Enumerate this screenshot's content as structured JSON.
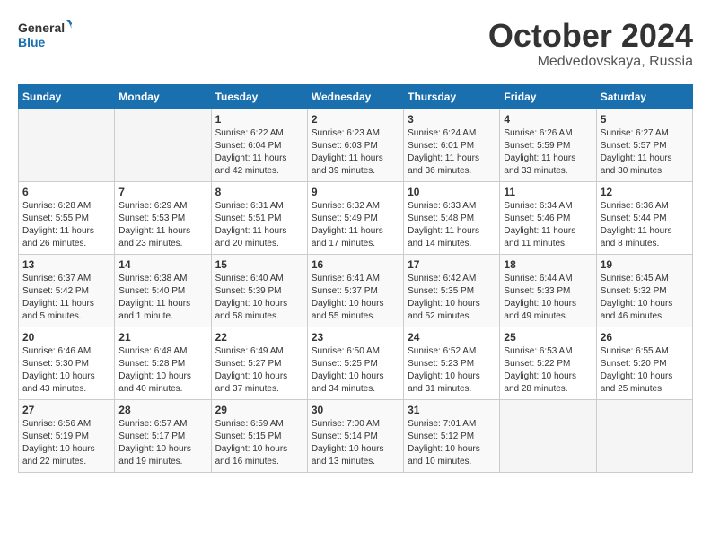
{
  "header": {
    "logo_line1": "General",
    "logo_line2": "Blue",
    "month": "October 2024",
    "location": "Medvedovskaya, Russia"
  },
  "weekdays": [
    "Sunday",
    "Monday",
    "Tuesday",
    "Wednesday",
    "Thursday",
    "Friday",
    "Saturday"
  ],
  "weeks": [
    [
      {
        "day": "",
        "sunrise": "",
        "sunset": "",
        "daylight": ""
      },
      {
        "day": "",
        "sunrise": "",
        "sunset": "",
        "daylight": ""
      },
      {
        "day": "1",
        "sunrise": "Sunrise: 6:22 AM",
        "sunset": "Sunset: 6:04 PM",
        "daylight": "Daylight: 11 hours and 42 minutes."
      },
      {
        "day": "2",
        "sunrise": "Sunrise: 6:23 AM",
        "sunset": "Sunset: 6:03 PM",
        "daylight": "Daylight: 11 hours and 39 minutes."
      },
      {
        "day": "3",
        "sunrise": "Sunrise: 6:24 AM",
        "sunset": "Sunset: 6:01 PM",
        "daylight": "Daylight: 11 hours and 36 minutes."
      },
      {
        "day": "4",
        "sunrise": "Sunrise: 6:26 AM",
        "sunset": "Sunset: 5:59 PM",
        "daylight": "Daylight: 11 hours and 33 minutes."
      },
      {
        "day": "5",
        "sunrise": "Sunrise: 6:27 AM",
        "sunset": "Sunset: 5:57 PM",
        "daylight": "Daylight: 11 hours and 30 minutes."
      }
    ],
    [
      {
        "day": "6",
        "sunrise": "Sunrise: 6:28 AM",
        "sunset": "Sunset: 5:55 PM",
        "daylight": "Daylight: 11 hours and 26 minutes."
      },
      {
        "day": "7",
        "sunrise": "Sunrise: 6:29 AM",
        "sunset": "Sunset: 5:53 PM",
        "daylight": "Daylight: 11 hours and 23 minutes."
      },
      {
        "day": "8",
        "sunrise": "Sunrise: 6:31 AM",
        "sunset": "Sunset: 5:51 PM",
        "daylight": "Daylight: 11 hours and 20 minutes."
      },
      {
        "day": "9",
        "sunrise": "Sunrise: 6:32 AM",
        "sunset": "Sunset: 5:49 PM",
        "daylight": "Daylight: 11 hours and 17 minutes."
      },
      {
        "day": "10",
        "sunrise": "Sunrise: 6:33 AM",
        "sunset": "Sunset: 5:48 PM",
        "daylight": "Daylight: 11 hours and 14 minutes."
      },
      {
        "day": "11",
        "sunrise": "Sunrise: 6:34 AM",
        "sunset": "Sunset: 5:46 PM",
        "daylight": "Daylight: 11 hours and 11 minutes."
      },
      {
        "day": "12",
        "sunrise": "Sunrise: 6:36 AM",
        "sunset": "Sunset: 5:44 PM",
        "daylight": "Daylight: 11 hours and 8 minutes."
      }
    ],
    [
      {
        "day": "13",
        "sunrise": "Sunrise: 6:37 AM",
        "sunset": "Sunset: 5:42 PM",
        "daylight": "Daylight: 11 hours and 5 minutes."
      },
      {
        "day": "14",
        "sunrise": "Sunrise: 6:38 AM",
        "sunset": "Sunset: 5:40 PM",
        "daylight": "Daylight: 11 hours and 1 minute."
      },
      {
        "day": "15",
        "sunrise": "Sunrise: 6:40 AM",
        "sunset": "Sunset: 5:39 PM",
        "daylight": "Daylight: 10 hours and 58 minutes."
      },
      {
        "day": "16",
        "sunrise": "Sunrise: 6:41 AM",
        "sunset": "Sunset: 5:37 PM",
        "daylight": "Daylight: 10 hours and 55 minutes."
      },
      {
        "day": "17",
        "sunrise": "Sunrise: 6:42 AM",
        "sunset": "Sunset: 5:35 PM",
        "daylight": "Daylight: 10 hours and 52 minutes."
      },
      {
        "day": "18",
        "sunrise": "Sunrise: 6:44 AM",
        "sunset": "Sunset: 5:33 PM",
        "daylight": "Daylight: 10 hours and 49 minutes."
      },
      {
        "day": "19",
        "sunrise": "Sunrise: 6:45 AM",
        "sunset": "Sunset: 5:32 PM",
        "daylight": "Daylight: 10 hours and 46 minutes."
      }
    ],
    [
      {
        "day": "20",
        "sunrise": "Sunrise: 6:46 AM",
        "sunset": "Sunset: 5:30 PM",
        "daylight": "Daylight: 10 hours and 43 minutes."
      },
      {
        "day": "21",
        "sunrise": "Sunrise: 6:48 AM",
        "sunset": "Sunset: 5:28 PM",
        "daylight": "Daylight: 10 hours and 40 minutes."
      },
      {
        "day": "22",
        "sunrise": "Sunrise: 6:49 AM",
        "sunset": "Sunset: 5:27 PM",
        "daylight": "Daylight: 10 hours and 37 minutes."
      },
      {
        "day": "23",
        "sunrise": "Sunrise: 6:50 AM",
        "sunset": "Sunset: 5:25 PM",
        "daylight": "Daylight: 10 hours and 34 minutes."
      },
      {
        "day": "24",
        "sunrise": "Sunrise: 6:52 AM",
        "sunset": "Sunset: 5:23 PM",
        "daylight": "Daylight: 10 hours and 31 minutes."
      },
      {
        "day": "25",
        "sunrise": "Sunrise: 6:53 AM",
        "sunset": "Sunset: 5:22 PM",
        "daylight": "Daylight: 10 hours and 28 minutes."
      },
      {
        "day": "26",
        "sunrise": "Sunrise: 6:55 AM",
        "sunset": "Sunset: 5:20 PM",
        "daylight": "Daylight: 10 hours and 25 minutes."
      }
    ],
    [
      {
        "day": "27",
        "sunrise": "Sunrise: 6:56 AM",
        "sunset": "Sunset: 5:19 PM",
        "daylight": "Daylight: 10 hours and 22 minutes."
      },
      {
        "day": "28",
        "sunrise": "Sunrise: 6:57 AM",
        "sunset": "Sunset: 5:17 PM",
        "daylight": "Daylight: 10 hours and 19 minutes."
      },
      {
        "day": "29",
        "sunrise": "Sunrise: 6:59 AM",
        "sunset": "Sunset: 5:15 PM",
        "daylight": "Daylight: 10 hours and 16 minutes."
      },
      {
        "day": "30",
        "sunrise": "Sunrise: 7:00 AM",
        "sunset": "Sunset: 5:14 PM",
        "daylight": "Daylight: 10 hours and 13 minutes."
      },
      {
        "day": "31",
        "sunrise": "Sunrise: 7:01 AM",
        "sunset": "Sunset: 5:12 PM",
        "daylight": "Daylight: 10 hours and 10 minutes."
      },
      {
        "day": "",
        "sunrise": "",
        "sunset": "",
        "daylight": ""
      },
      {
        "day": "",
        "sunrise": "",
        "sunset": "",
        "daylight": ""
      }
    ]
  ]
}
